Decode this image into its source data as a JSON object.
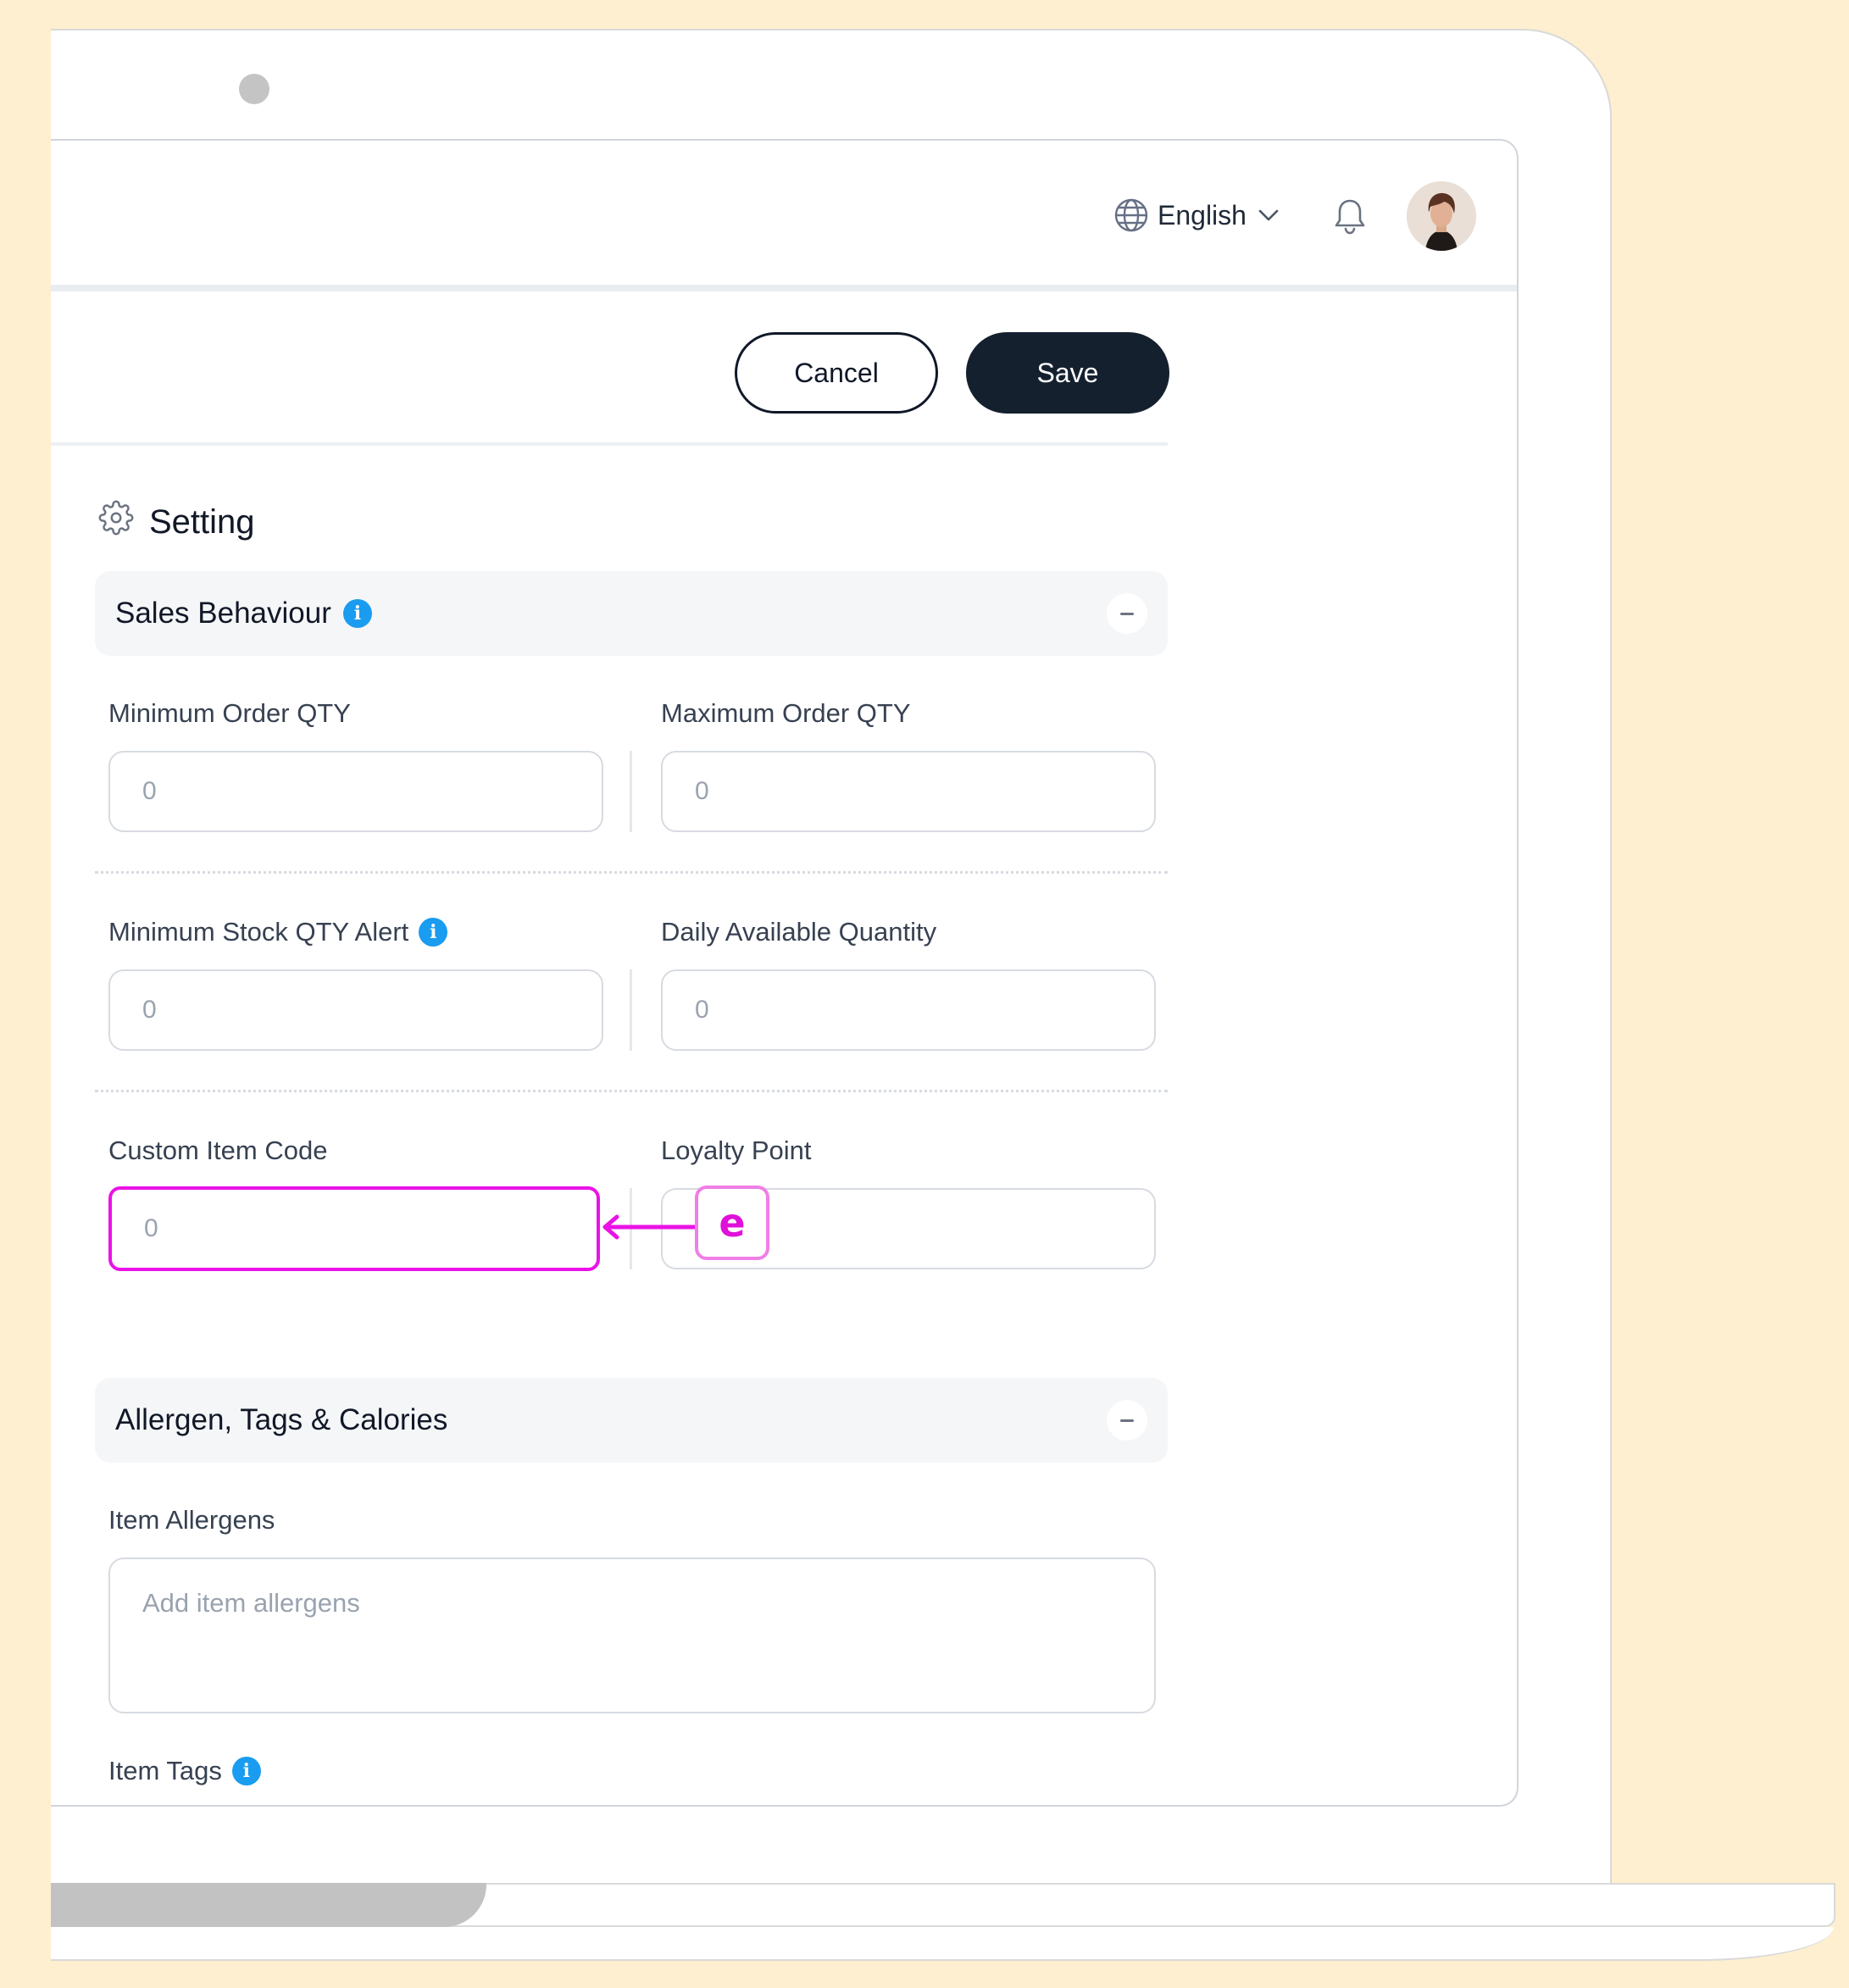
{
  "header": {
    "language": "English"
  },
  "actions": {
    "cancel_label": "Cancel",
    "save_label": "Save"
  },
  "setting": {
    "title": "Setting"
  },
  "sales_behaviour": {
    "title": "Sales Behaviour",
    "fields": {
      "min_order": {
        "label": "Minimum Order QTY",
        "value": "0"
      },
      "max_order": {
        "label": "Maximum Order QTY",
        "value": "0"
      },
      "min_stock_alert": {
        "label": "Minimum Stock QTY Alert",
        "value": "0"
      },
      "daily_available": {
        "label": "Daily Available Quantity",
        "value": "0"
      },
      "custom_item_code": {
        "label": "Custom Item Code",
        "value": "0"
      },
      "loyalty_point": {
        "label": "Loyalty Point",
        "value": ""
      }
    }
  },
  "allergen_section": {
    "title": "Allergen, Tags & Calories",
    "item_allergens": {
      "label": "Item Allergens",
      "placeholder": "Add item allergens"
    },
    "item_tags": {
      "label": "Item Tags"
    }
  },
  "annotation": {
    "badge": "e",
    "color": "#ea12e6"
  },
  "colors": {
    "background": "#fdefcf",
    "primary_button": "#15202f",
    "info": "#1a9cf0"
  },
  "icons": [
    "globe-icon",
    "chevron-down-icon",
    "bell-icon",
    "gear-icon",
    "info-icon",
    "minus-icon"
  ]
}
